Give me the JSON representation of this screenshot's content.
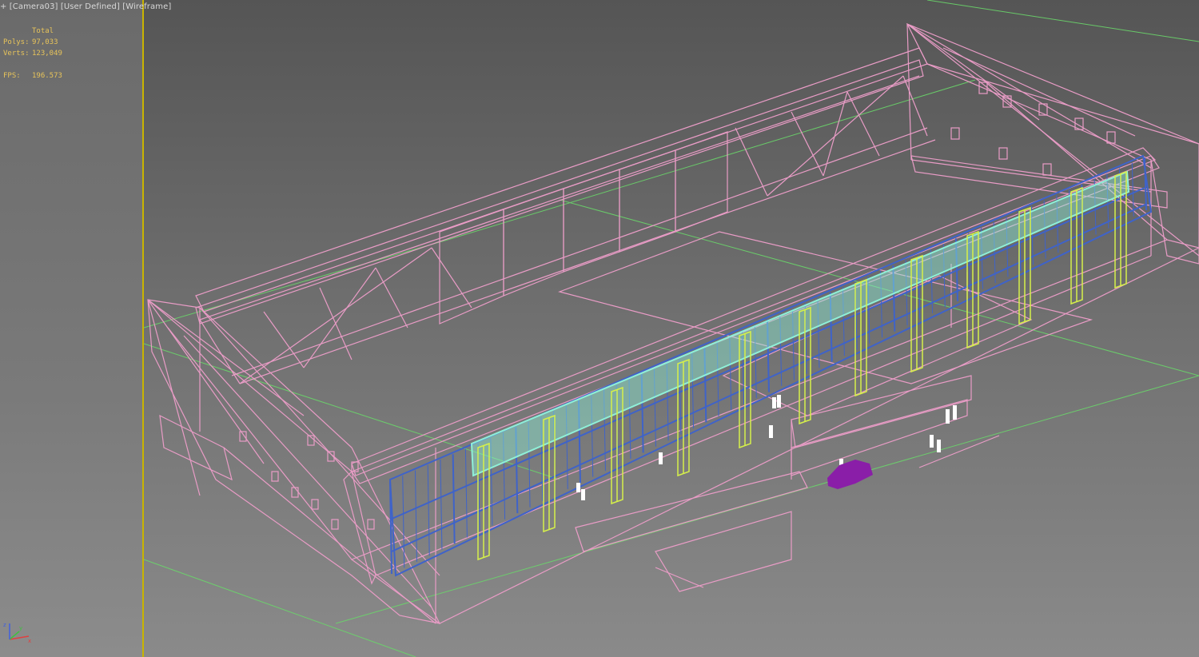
{
  "viewport": {
    "label_prefix": "+",
    "camera": "[Camera03]",
    "shading_mode": "[User Defined]",
    "render_mode": "[Wireframe]"
  },
  "stats": {
    "header": "Total",
    "polys_label": "Polys:",
    "polys_value": "97,033",
    "verts_label": "Verts:",
    "verts_value": "123,049",
    "fps_label": "FPS:",
    "fps_value": "196.573"
  },
  "colors": {
    "wire_pink": "#e99cc6",
    "wire_blue": "#3f63c9",
    "wire_cyan": "#8ff0d8",
    "wire_yellow": "#d6f04a",
    "car_purple": "#8a1ea8",
    "grid_green": "#6ad66a",
    "border_yellow": "#c9b400",
    "stats_text": "#e8c45a"
  },
  "axis_gizmo": {
    "x": "x",
    "y": "y",
    "z": "z"
  }
}
